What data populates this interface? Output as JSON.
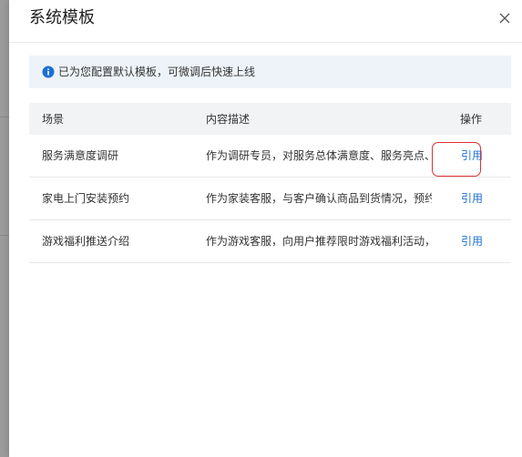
{
  "dialog": {
    "title": "系统模板"
  },
  "notice": {
    "icon": "info-circle-icon",
    "text": "已为您配置默认模板，可微调后快速上线"
  },
  "table": {
    "columns": {
      "scene": "场景",
      "content": "内容描述",
      "action": "操作"
    },
    "rows": [
      {
        "scene": "服务满意度调研",
        "content": "作为调研专员，对服务总体满意度、服务亮点、改…",
        "action": "引用"
      },
      {
        "scene": "家电上门安装预约",
        "content": "作为家装客服，与客户确认商品到货情况，预约上…",
        "action": "引用"
      },
      {
        "scene": "游戏福利推送介绍",
        "content": "作为游戏客服，向用户推荐限时游戏福利活动，强…",
        "action": "引用"
      }
    ]
  },
  "colors": {
    "link": "#1d6fd1",
    "notice_bg": "#eef3f9",
    "header_bg": "#f1f3f5",
    "highlight": "#e03131"
  }
}
